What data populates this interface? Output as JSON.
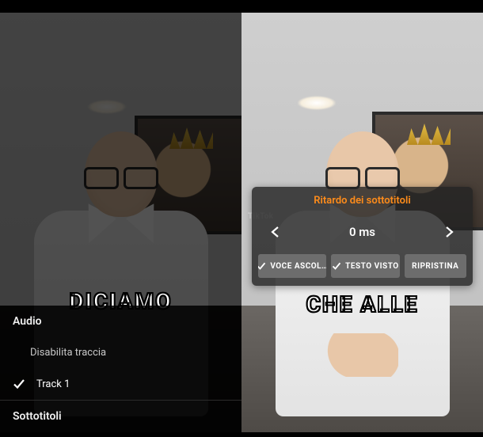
{
  "left": {
    "subtitle": "DICIAMO",
    "audio": {
      "heading": "Audio",
      "disable": "Disabilita traccia",
      "track1": "Track 1"
    },
    "subs": {
      "heading": "Sottotitoli"
    }
  },
  "right": {
    "subtitle": "CHE ALLE",
    "watermark": "TikTok",
    "panel": {
      "title": "Ritardo dei sottotitoli",
      "value": "0 ms",
      "voice": "VOCE ASCOL…",
      "text": "TESTO VISTO",
      "reset": "RIPRISTINA"
    }
  }
}
